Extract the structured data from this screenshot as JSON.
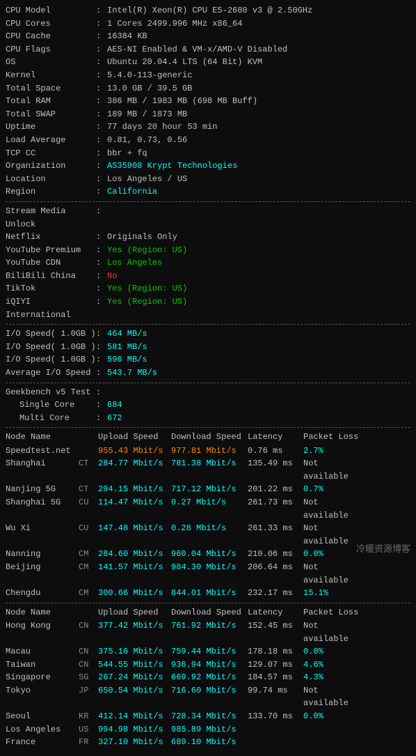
{
  "system": {
    "cpu_model_label": "CPU Model",
    "cpu_model_value": "Intel(R) Xeon(R) CPU E5-2680 v3 @ 2.50GHz",
    "cpu_cores_label": "CPU Cores",
    "cpu_cores_value": "1 Cores 2499.996 MHz x86_64",
    "cpu_cache_label": "CPU Cache",
    "cpu_cache_value": "16384 KB",
    "cpu_flags_label": "CPU Flags",
    "cpu_flags_value": "AES-NI Enabled & VM-x/AMD-V Disabled",
    "os_label": "OS",
    "os_value": "Ubuntu 20.04.4 LTS (64 Bit) KVM",
    "kernel_label": "Kernel",
    "kernel_value": "5.4.0-113-generic",
    "total_space_label": "Total Space",
    "total_space_value": "13.0 GB / 39.5 GB",
    "total_ram_label": "Total RAM",
    "total_ram_value": "386 MB / 1983 MB (698 MB Buff)",
    "total_swap_label": "Total SWAP",
    "total_swap_value": "189 MB / 1873 MB",
    "uptime_label": "Uptime",
    "uptime_value": "77 days 20 hour 53 min",
    "load_avg_label": "Load Average",
    "load_avg_value": "0.81, 0.73, 0.56",
    "tcp_cc_label": "TCP CC",
    "tcp_cc_value": "bbr + fq",
    "org_label": "Organization",
    "org_value": "AS35908 Krypt Technologies",
    "location_label": "Location",
    "location_value": "Los Angeles / US",
    "region_label": "Region",
    "region_value": "California"
  },
  "media": {
    "section_label": "Stream Media Unlock",
    "netflix_label": "Netflix",
    "netflix_value": "Originals Only",
    "youtube_premium_label": "YouTube Premium",
    "youtube_premium_value": "Yes (Region: US)",
    "youtube_cdn_label": "YouTube CDN",
    "youtube_cdn_value": "Los Angeles",
    "bilibili_label": "BiliBili China",
    "bilibili_value": "No",
    "tiktok_label": "TikTok",
    "tiktok_value": "Yes (Region: US)",
    "iqiyi_label": "iQIYI International",
    "iqiyi_value": "Yes (Region: US)"
  },
  "io": {
    "row1_label": "I/O Speed( 1.0GB )",
    "row1_value": "464 MB/s",
    "row2_label": "I/O Speed( 1.0GB )",
    "row2_value": "581 MB/s",
    "row3_label": "I/O Speed( 1.0GB )",
    "row3_value": "596 MB/s",
    "avg_label": "Average I/O Speed",
    "avg_value": "543.7 MB/s"
  },
  "geekbench": {
    "section_label": "Geekbench v5 Test",
    "single_label": "Single Core",
    "single_value": "684",
    "multi_label": "Multi Core",
    "multi_value": "672"
  },
  "network_table1": {
    "headers": {
      "node": "Node Name",
      "upload": "Upload Speed",
      "download": "Download Speed",
      "latency": "Latency",
      "loss": "Packet Loss"
    },
    "rows": [
      {
        "node": "Speedtest.net",
        "isp": "",
        "upload": "955.43 Mbit/s",
        "download": "977.81 Mbit/s",
        "latency": "0.76 ms",
        "loss": "2.7%",
        "upload_color": "orange",
        "download_color": "orange",
        "loss_color": "cyan"
      },
      {
        "node": "Shanghai",
        "isp": "CT",
        "upload": "284.77 Mbit/s",
        "download": "781.38 Mbit/s",
        "latency": "135.49 ms",
        "loss": "Not available",
        "upload_color": "cyan",
        "download_color": "cyan",
        "loss_color": "default"
      },
      {
        "node": "Nanjing 5G",
        "isp": "CT",
        "upload": "294.15 Mbit/s",
        "download": "717.12 Mbit/s",
        "latency": "201.22 ms",
        "loss": "0.7%",
        "upload_color": "cyan",
        "download_color": "cyan",
        "loss_color": "cyan"
      },
      {
        "node": "Shanghai 5G",
        "isp": "CU",
        "upload": "114.47 Mbit/s",
        "download": "0.27 Mbit/s",
        "latency": "261.73 ms",
        "loss": "Not available",
        "upload_color": "cyan",
        "download_color": "cyan",
        "loss_color": "default"
      },
      {
        "node": "Wu Xi",
        "isp": "CU",
        "upload": "147.48 Mbit/s",
        "download": "0.28 Mbit/s",
        "latency": "261.33 ms",
        "loss": "Not available",
        "upload_color": "cyan",
        "download_color": "cyan",
        "loss_color": "default"
      },
      {
        "node": "Nanning",
        "isp": "CM",
        "upload": "284.60 Mbit/s",
        "download": "960.04 Mbit/s",
        "latency": "210.06 ms",
        "loss": "0.0%",
        "upload_color": "cyan",
        "download_color": "cyan",
        "loss_color": "cyan"
      },
      {
        "node": "Beijing",
        "isp": "CM",
        "upload": "141.57 Mbit/s",
        "download": "984.30 Mbit/s",
        "latency": "206.64 ms",
        "loss": "Not available",
        "upload_color": "cyan",
        "download_color": "cyan",
        "loss_color": "default"
      },
      {
        "node": "Chengdu",
        "isp": "CM",
        "upload": "300.66 Mbit/s",
        "download": "844.01 Mbit/s",
        "latency": "232.17 ms",
        "loss": "15.1%",
        "upload_color": "cyan",
        "download_color": "cyan",
        "loss_color": "cyan"
      }
    ]
  },
  "network_table2": {
    "headers": {
      "node": "Node Name",
      "upload": "Upload Speed",
      "download": "Download Speed",
      "latency": "Latency",
      "loss": "Packet Loss"
    },
    "rows": [
      {
        "node": "Hong Kong",
        "isp": "CN",
        "upload": "377.42 Mbit/s",
        "download": "761.92 Mbit/s",
        "latency": "152.45 ms",
        "loss": "Not available",
        "upload_color": "cyan",
        "download_color": "cyan"
      },
      {
        "node": "Macau",
        "isp": "CN",
        "upload": "375.16 Mbit/s",
        "download": "759.44 Mbit/s",
        "latency": "178.18 ms",
        "loss": "0.0%",
        "upload_color": "cyan",
        "download_color": "cyan"
      },
      {
        "node": "Taiwan",
        "isp": "CN",
        "upload": "544.55 Mbit/s",
        "download": "936.94 Mbit/s",
        "latency": "129.07 ms",
        "loss": "4.6%",
        "upload_color": "cyan",
        "download_color": "cyan"
      },
      {
        "node": "Singapore",
        "isp": "SG",
        "upload": "267.24 Mbit/s",
        "download": "669.92 Mbit/s",
        "latency": "184.57 ms",
        "loss": "4.3%",
        "upload_color": "cyan",
        "download_color": "cyan"
      },
      {
        "node": "Tokyo",
        "isp": "JP",
        "upload": "650.54 Mbit/s",
        "download": "716.60 Mbit/s",
        "latency": "99.74 ms",
        "loss": "Not available",
        "upload_color": "cyan",
        "download_color": "cyan"
      },
      {
        "node": "Seoul",
        "isp": "KR",
        "upload": "412.14 Mbit/s",
        "download": "728.34 Mbit/s",
        "latency": "133.70 ms",
        "loss": "0.0%",
        "upload_color": "cyan",
        "download_color": "cyan"
      },
      {
        "node": "Los Angeles",
        "isp": "US",
        "upload": "994.98 Mbit/s",
        "download": "985.89 Mbit/s",
        "latency": "",
        "loss": "",
        "upload_color": "cyan",
        "download_color": "cyan"
      },
      {
        "node": "France",
        "isp": "FR",
        "upload": "327.10 Mbit/s",
        "download": "689.10 Mbit/s",
        "latency": "",
        "loss": "",
        "upload_color": "cyan",
        "download_color": "cyan"
      }
    ]
  },
  "watermark": "冷暖资源博客"
}
